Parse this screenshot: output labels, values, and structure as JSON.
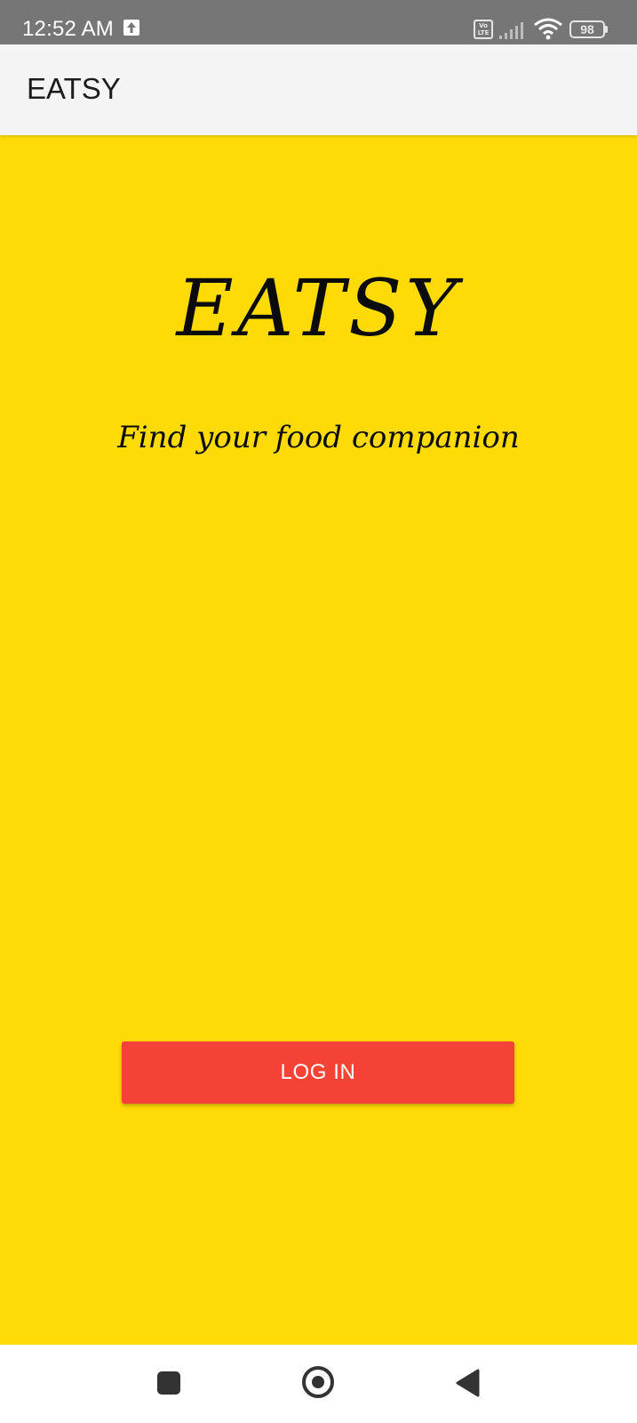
{
  "status_bar": {
    "time": "12:52 AM",
    "upload_icon": "upload-arrow-icon",
    "volte": "Vo\nLTE",
    "signal_icon": "cell-signal-icon",
    "wifi_icon": "wifi-icon",
    "battery_level": "98"
  },
  "app_bar": {
    "title": "EATSY"
  },
  "main": {
    "logo_text": "EATSY",
    "tagline": "Find your food companion",
    "login_label": "LOG IN",
    "background_color": "#fedb06",
    "button_color": "#f44336"
  },
  "nav_bar": {
    "recents_icon": "square-recents-icon",
    "home_icon": "circle-home-icon",
    "back_icon": "triangle-back-icon"
  }
}
